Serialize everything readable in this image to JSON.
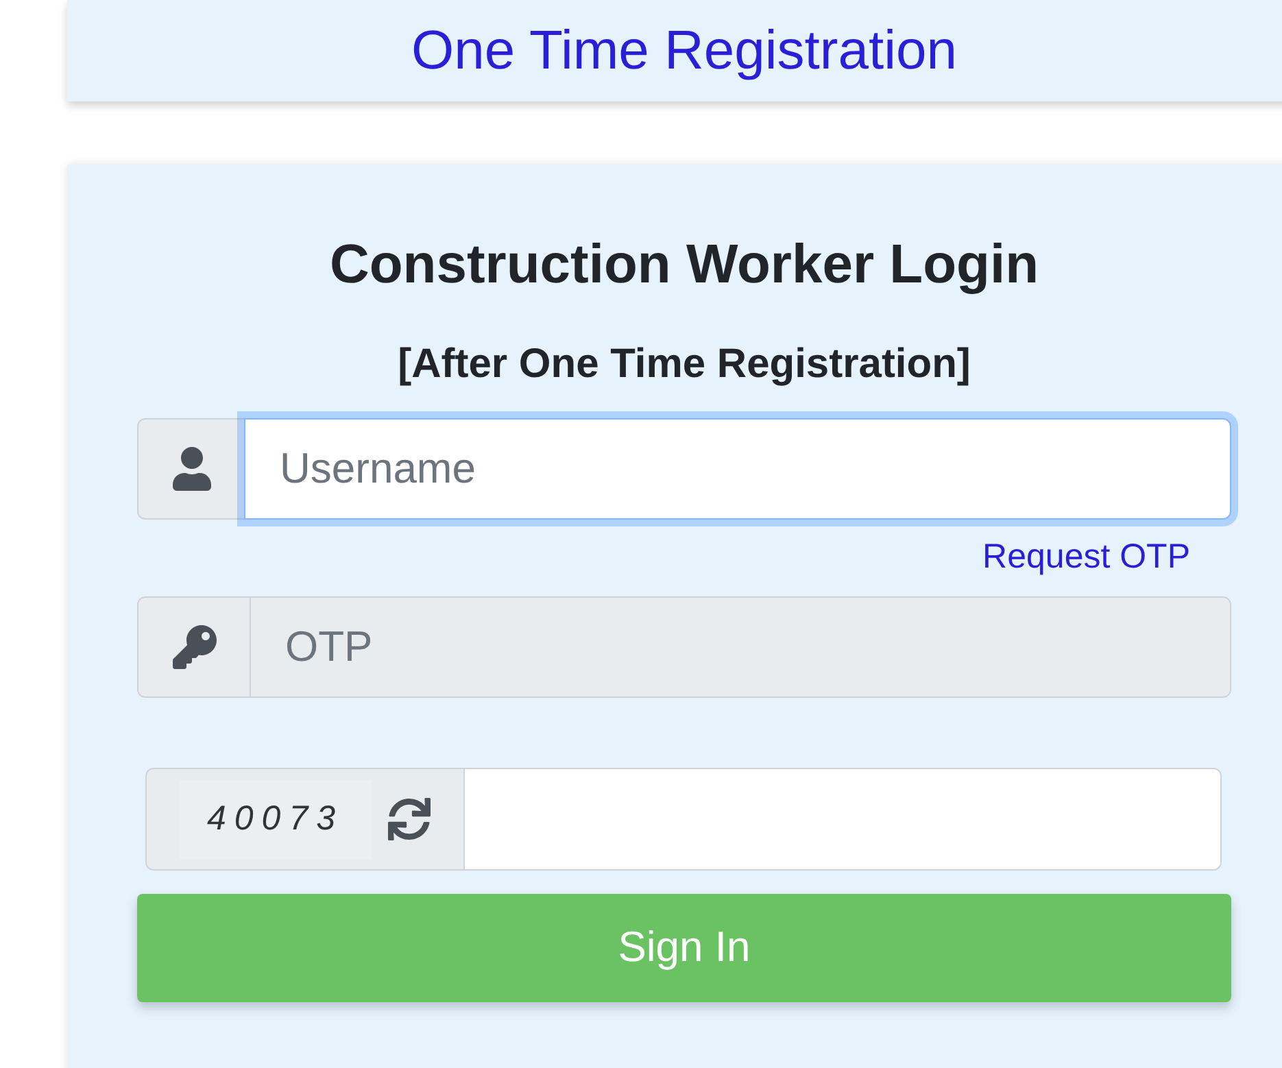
{
  "header": {
    "title": "One Time Registration"
  },
  "login_card": {
    "title": "Construction Worker Login",
    "subtitle": "[After One Time Registration]",
    "fields": [
      {
        "kind": "username",
        "placeholder": "Username",
        "focused": true,
        "disabled": false
      },
      {
        "kind": "otp",
        "placeholder": "OTP",
        "focused": false,
        "disabled": true
      }
    ],
    "request_otp_link": "Request OTP",
    "captcha": {
      "code": "40073"
    },
    "sign_in_button": "Sign In"
  }
}
